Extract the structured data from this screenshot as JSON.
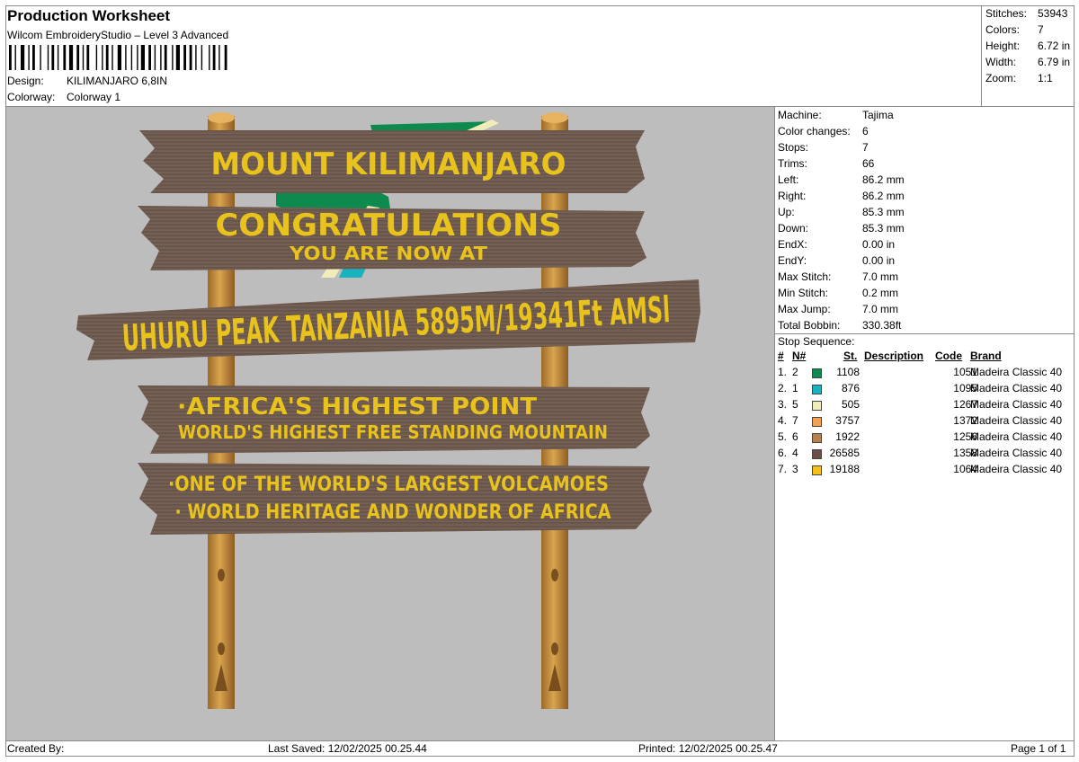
{
  "header": {
    "title": "Production Worksheet",
    "software": "Wilcom EmbroideryStudio – Level 3 Advanced",
    "design_label": "Design:",
    "design_value": "KILIMANJARO 6,8IN",
    "colorway_label": "Colorway:",
    "colorway_value": "Colorway 1"
  },
  "stats": [
    {
      "label": "Stitches:",
      "value": "53943"
    },
    {
      "label": "Colors:",
      "value": "7"
    },
    {
      "label": "Height:",
      "value": "6.72 in"
    },
    {
      "label": "Width:",
      "value": "6.79 in"
    },
    {
      "label": "Zoom:",
      "value": "1:1"
    }
  ],
  "machine_info": [
    {
      "label": "Machine:",
      "value": "Tajima"
    },
    {
      "label": "Color changes:",
      "value": "6"
    },
    {
      "label": "Stops:",
      "value": "7"
    },
    {
      "label": "Trims:",
      "value": "66"
    },
    {
      "label": "Left:",
      "value": "86.2 mm"
    },
    {
      "label": "Right:",
      "value": "86.2 mm"
    },
    {
      "label": "Up:",
      "value": "85.3 mm"
    },
    {
      "label": "Down:",
      "value": "85.3 mm"
    },
    {
      "label": "EndX:",
      "value": "0.00 in"
    },
    {
      "label": "EndY:",
      "value": "0.00 in"
    },
    {
      "label": "Max Stitch:",
      "value": "7.0 mm"
    },
    {
      "label": "Min Stitch:",
      "value": "0.2 mm"
    },
    {
      "label": "Max Jump:",
      "value": "7.0 mm"
    },
    {
      "label": "Total Bobbin:",
      "value": "330.38ft"
    }
  ],
  "stop_sequence": {
    "title": "Stop Sequence:",
    "headers": {
      "num": "#",
      "n": "N#",
      "st": "St.",
      "desc": "Description",
      "code": "Code",
      "brand": "Brand"
    },
    "rows": [
      {
        "num": "1.",
        "n": "2",
        "color": "#0e8a4e",
        "st": "1108",
        "desc": "",
        "code": "1051",
        "brand": "Madeira Classic 40"
      },
      {
        "num": "2.",
        "n": "1",
        "color": "#19b2bf",
        "st": "876",
        "desc": "",
        "code": "1095",
        "brand": "Madeira Classic 40"
      },
      {
        "num": "3.",
        "n": "5",
        "color": "#f0edbb",
        "st": "505",
        "desc": "",
        "code": "1267",
        "brand": "Madeira Classic 40"
      },
      {
        "num": "4.",
        "n": "7",
        "color": "#f0a255",
        "st": "3757",
        "desc": "",
        "code": "1372",
        "brand": "Madeira Classic 40"
      },
      {
        "num": "5.",
        "n": "6",
        "color": "#b5814e",
        "st": "1922",
        "desc": "",
        "code": "1256",
        "brand": "Madeira Classic 40"
      },
      {
        "num": "6.",
        "n": "4",
        "color": "#6b4f46",
        "st": "26585",
        "desc": "",
        "code": "1358",
        "brand": "Madeira Classic 40"
      },
      {
        "num": "7.",
        "n": "3",
        "color": "#f2c21a",
        "st": "19188",
        "desc": "",
        "code": "1064",
        "brand": "Madeira Classic 40"
      }
    ]
  },
  "design": {
    "sign1": "MOUNT KILIMANJARO",
    "sign2_line1": "CONGRATULATIONS",
    "sign2_line2": "YOU ARE NOW AT",
    "sign3": "UHURU PEAK TANZANIA 5895M/19341Ft AMSl",
    "sign4_line1": "·AFRICA'S HIGHEST POINT",
    "sign4_line2": "WORLD'S HIGHEST FREE STANDING MOUNTAIN",
    "sign5_line1": "·ONE OF THE WORLD'S LARGEST VOLCAMOES",
    "sign5_line2": "· WORLD HERITAGE AND WONDER OF AFRICA",
    "colors": {
      "background": "#bdbdbd",
      "board": "#6e5a4f",
      "post": "#c8903e",
      "text": "#e8c21d"
    }
  },
  "footer": {
    "created_by": "Created By:",
    "last_saved": "Last Saved: 12/02/2025 00.25.44",
    "printed": "Printed: 12/02/2025 00.25.47",
    "page": "Page 1 of 1"
  }
}
